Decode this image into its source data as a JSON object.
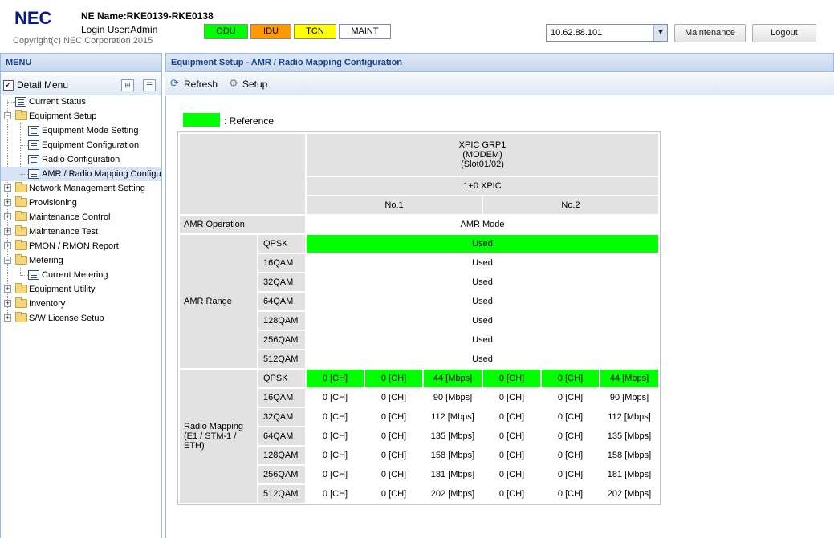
{
  "header": {
    "logo": "NEC",
    "ne_name": "NE Name:RKE0139-RKE0138",
    "login_user": "Login User:Admin",
    "copyright": "Copyright(c) NEC Corporation 2015",
    "status": {
      "odu": "ODU",
      "idu": "IDU",
      "tcn": "TCN",
      "maint": "MAINT"
    },
    "status_colors": {
      "odu": "#00ff00",
      "idu": "#ff9900",
      "tcn": "#ffff00",
      "maint": "#ffffff"
    },
    "ip_select": "10.62.88.101",
    "maintenance_button": "Maintenance",
    "logout_button": "Logout"
  },
  "menu": {
    "title": "MENU",
    "detail_menu": "Detail Menu",
    "items": [
      {
        "label": "Current Status",
        "icon": "page-icon"
      },
      {
        "label": "Equipment Setup",
        "icon": "folder-icon",
        "expanded": true
      },
      {
        "label": "Equipment Mode Setting",
        "icon": "page-icon"
      },
      {
        "label": "Equipment Configuration",
        "icon": "page-icon"
      },
      {
        "label": "Radio Configuration",
        "icon": "page-icon"
      },
      {
        "label": "AMR / Radio Mapping Configura",
        "icon": "page-icon",
        "selected": true
      },
      {
        "label": "Network Management Setting",
        "icon": "folder-icon"
      },
      {
        "label": "Provisioning",
        "icon": "folder-icon"
      },
      {
        "label": "Maintenance Control",
        "icon": "folder-icon"
      },
      {
        "label": "Maintenance Test",
        "icon": "folder-icon"
      },
      {
        "label": "PMON / RMON Report",
        "icon": "folder-icon"
      },
      {
        "label": "Metering",
        "icon": "folder-icon",
        "expanded": true
      },
      {
        "label": "Current Metering",
        "icon": "page-icon"
      },
      {
        "label": "Equipment Utility",
        "icon": "folder-icon"
      },
      {
        "label": "Inventory",
        "icon": "folder-icon"
      },
      {
        "label": "S/W License Setup",
        "icon": "folder-icon"
      }
    ]
  },
  "main": {
    "title": "Equipment Setup - AMR / Radio Mapping Configuration",
    "toolbar": {
      "refresh": "Refresh",
      "setup": "Setup"
    },
    "reference_label": ": Reference",
    "reference_color": "#00ff00",
    "table": {
      "group_line1": "XPIC GRP1",
      "group_line2": "(MODEM)",
      "group_line3": "(Slot01/02)",
      "config": "1+0 XPIC",
      "no1": "No.1",
      "no2": "No.2",
      "amr_operation_label": "AMR Operation",
      "amr_operation_value": "AMR Mode",
      "amr_range_label": "AMR Range",
      "amr_range": [
        {
          "mod": "QPSK",
          "value": "Used",
          "reference": true
        },
        {
          "mod": "16QAM",
          "value": "Used"
        },
        {
          "mod": "32QAM",
          "value": "Used"
        },
        {
          "mod": "64QAM",
          "value": "Used"
        },
        {
          "mod": "128QAM",
          "value": "Used"
        },
        {
          "mod": "256QAM",
          "value": "Used"
        },
        {
          "mod": "512QAM",
          "value": "Used"
        }
      ],
      "radio_mapping_label_1": "Radio Mapping",
      "radio_mapping_label_2": "(E1 / STM-1 / ETH)",
      "radio_mapping": [
        {
          "mod": "QPSK",
          "cells": [
            "0 [CH]",
            "0 [CH]",
            "44 [Mbps]",
            "0 [CH]",
            "0 [CH]",
            "44 [Mbps]"
          ],
          "reference": true
        },
        {
          "mod": "16QAM",
          "cells": [
            "0 [CH]",
            "0 [CH]",
            "90 [Mbps]",
            "0 [CH]",
            "0 [CH]",
            "90 [Mbps]"
          ]
        },
        {
          "mod": "32QAM",
          "cells": [
            "0 [CH]",
            "0 [CH]",
            "112 [Mbps]",
            "0 [CH]",
            "0 [CH]",
            "112 [Mbps]"
          ]
        },
        {
          "mod": "64QAM",
          "cells": [
            "0 [CH]",
            "0 [CH]",
            "135 [Mbps]",
            "0 [CH]",
            "0 [CH]",
            "135 [Mbps]"
          ]
        },
        {
          "mod": "128QAM",
          "cells": [
            "0 [CH]",
            "0 [CH]",
            "158 [Mbps]",
            "0 [CH]",
            "0 [CH]",
            "158 [Mbps]"
          ]
        },
        {
          "mod": "256QAM",
          "cells": [
            "0 [CH]",
            "0 [CH]",
            "181 [Mbps]",
            "0 [CH]",
            "0 [CH]",
            "181 [Mbps]"
          ]
        },
        {
          "mod": "512QAM",
          "cells": [
            "0 [CH]",
            "0 [CH]",
            "202 [Mbps]",
            "0 [CH]",
            "0 [CH]",
            "202 [Mbps]"
          ]
        }
      ]
    }
  }
}
